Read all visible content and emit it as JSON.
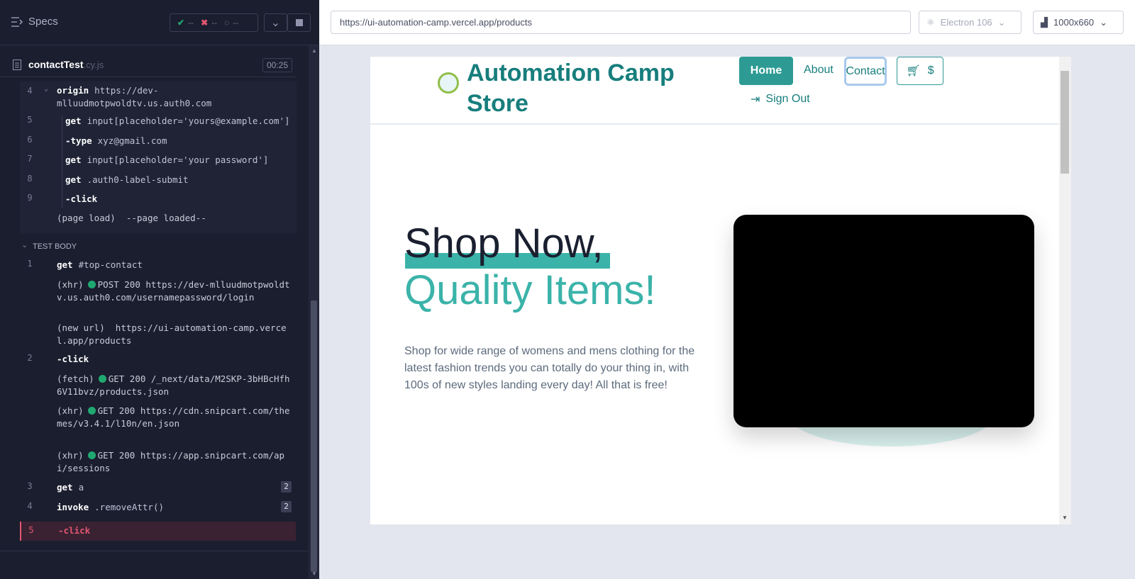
{
  "runner": {
    "specs_label": "Specs",
    "passed": "--",
    "failed": "--",
    "pending": "--",
    "file": {
      "name": "contactTest",
      "ext": ".cy.js",
      "timer": "00:25"
    }
  },
  "hooks": [
    {
      "num": "4",
      "cmd": "origin",
      "msg": "https://dev-mlluudmotpwoldtv.us.auth0.com"
    },
    {
      "num": "5",
      "cmd": "get",
      "msg": "input[placeholder='yours@example.com']"
    },
    {
      "num": "6",
      "cmd": "-type",
      "msg": "xyz@gmail.com"
    },
    {
      "num": "7",
      "cmd": "get",
      "msg": "input[placeholder='your password']"
    },
    {
      "num": "8",
      "cmd": "get",
      "msg": ".auth0-label-submit"
    },
    {
      "num": "9",
      "cmd": "-click",
      "msg": ""
    },
    {
      "num": "",
      "cmd": "(page load)",
      "msg": "--page loaded--"
    }
  ],
  "test_body_label": "TEST BODY",
  "commands": [
    {
      "num": "1",
      "cmd": "get",
      "msg": "#top-contact"
    },
    {
      "num": "",
      "cmd": "(xhr)",
      "status": "POST 200",
      "msg": "https://dev-mlluudmotpwoldtv.us.auth0.com/usernamepassword/login"
    },
    {
      "num": "",
      "cmd": "(new url)",
      "msg": "https://ui-automation-camp.vercel.app/products"
    },
    {
      "num": "2",
      "cmd": "-click",
      "msg": ""
    },
    {
      "num": "",
      "cmd": "(fetch)",
      "status": "GET 200",
      "msg": "/_next/data/M2SKP-3bHBcHfh6V11bvz/products.json"
    },
    {
      "num": "",
      "cmd": "(xhr)",
      "status": "GET 200",
      "msg": "https://cdn.snipcart.com/themes/v3.4.1/l10n/en.json"
    },
    {
      "num": "",
      "cmd": "(xhr)",
      "status": "GET 200",
      "msg": "https://app.snipcart.com/api/sessions"
    },
    {
      "num": "3",
      "cmd": "get",
      "msg": "a",
      "count": "2"
    },
    {
      "num": "4",
      "cmd": "invoke",
      "msg": ".removeAttr()",
      "count": "2"
    },
    {
      "num": "5",
      "cmd": "-click",
      "msg": ""
    }
  ],
  "browser": {
    "url": "https://ui-automation-camp.vercel.app/products",
    "engine": "Electron 106",
    "viewport": "1000x660"
  },
  "site": {
    "brand_line1": "Automation Camp",
    "brand_line2": "Store",
    "nav_home": "Home",
    "nav_about": "About",
    "nav_contact": "Contact",
    "cart_label": "$",
    "sign_out": "Sign Out",
    "hero_line1": "Shop Now,",
    "hero_line2": "Quality Items!",
    "hero_text": "Shop for wide range of womens and mens clothing for the latest fashion trends you can totally do your thing in, with 100s of new styles landing every day! All that is free!"
  },
  "colors": {
    "accent": "#177e7d",
    "teal": "#3bb3a9",
    "runner_bg": "#1b1e2e",
    "fail": "#e45770"
  }
}
